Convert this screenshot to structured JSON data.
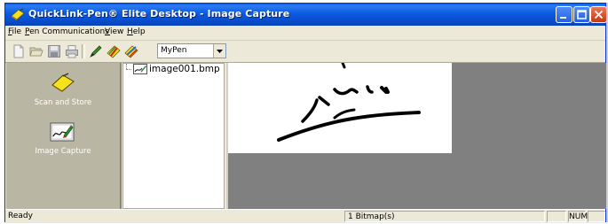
{
  "window": {
    "title": "QuickLink-Pen® Elite Desktop - Image Capture",
    "icon": "quicklink-pen-icon"
  },
  "menu": [
    {
      "accel": "F",
      "rest": "ile"
    },
    {
      "accel": "P",
      "rest": "en Communications"
    },
    {
      "accel": "V",
      "rest": "iew"
    },
    {
      "accel": "H",
      "rest": "elp"
    }
  ],
  "toolbar": {
    "icons": [
      "new-document-icon",
      "open-folder-icon",
      "save-icon",
      "print-icon",
      "pen-icon",
      "pen-settings-icon",
      "pen-scan-icon"
    ],
    "pen_select_value": "MyPen"
  },
  "left_panel": {
    "items": [
      {
        "label": "Scan and Store",
        "icon": "scan-and-store-icon"
      },
      {
        "label": "Image Capture",
        "icon": "image-capture-icon"
      }
    ]
  },
  "tree": {
    "items": [
      {
        "label": "image001.bmp",
        "icon": "bitmap-file-icon"
      }
    ]
  },
  "status": {
    "text": "Ready",
    "count": "1 Bitmap(s)",
    "num": "NUM"
  },
  "colors": {
    "title_bar": "#0a5ce8",
    "panel": "#b9b7a3",
    "viewer_background": "#808080"
  }
}
